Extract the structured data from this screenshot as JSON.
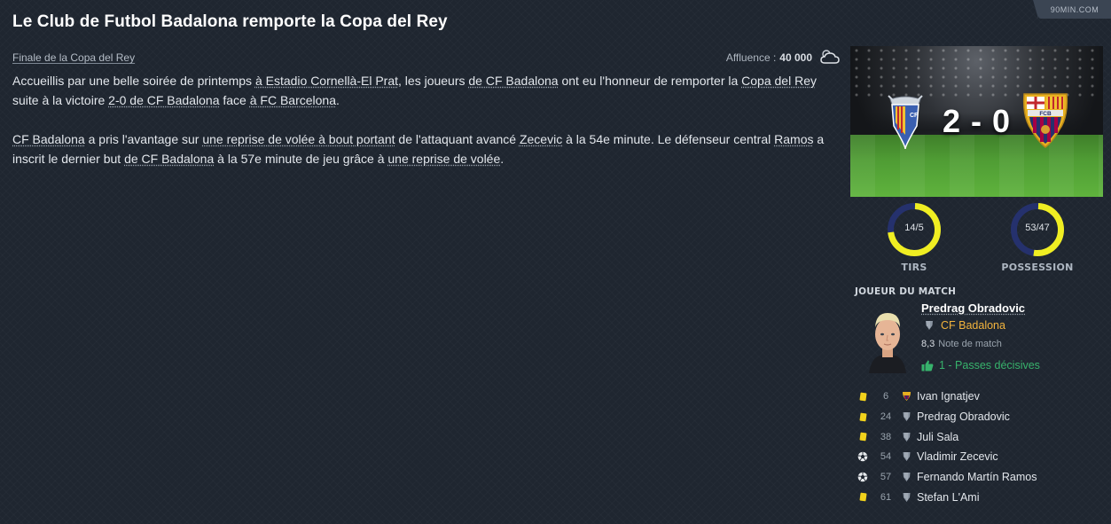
{
  "source": "90MIN.COM",
  "title": "Le Club de Futbol Badalona remporte la Copa del Rey",
  "subtitle": "Finale de la Copa del Rey",
  "attendance": {
    "label": "Affluence :",
    "value": "40 000",
    "weather_icon": "cloudy-icon"
  },
  "article": {
    "p1": [
      {
        "t": "Accueillis par une belle soirée de printemps "
      },
      {
        "t": "à Estadio Cornellà-El Prat",
        "link": true
      },
      {
        "t": ", les joueurs "
      },
      {
        "t": "de CF Badalona",
        "link": true
      },
      {
        "t": " ont eu l'honneur de remporter la "
      },
      {
        "t": "Copa del Rey",
        "link": true
      },
      {
        "t": " suite à la victoire "
      },
      {
        "t": "2-0 de CF Badalona",
        "link": true
      },
      {
        "t": " face "
      },
      {
        "t": "à FC Barcelona",
        "link": true
      },
      {
        "t": "."
      }
    ],
    "p2": [
      {
        "t": "CF Badalona",
        "link": true
      },
      {
        "t": " a pris l'avantage sur "
      },
      {
        "t": "une reprise de volée à bout portant",
        "link": true
      },
      {
        "t": " de l'attaquant avancé "
      },
      {
        "t": "Zecevic",
        "link": true
      },
      {
        "t": " à la 54e minute. Le défenseur central "
      },
      {
        "t": "Ramos",
        "link": true
      },
      {
        "t": " a inscrit le dernier but "
      },
      {
        "t": "de CF Badalona",
        "link": true
      },
      {
        "t": " à la 57e minute de jeu grâce à "
      },
      {
        "t": "une reprise de volée",
        "link": true
      },
      {
        "t": "."
      }
    ]
  },
  "match": {
    "score": "2 - 0",
    "home_team": "CF Badalona",
    "away_team": "FC Barcelona"
  },
  "stats": [
    {
      "key": "shots",
      "label": "TIRS",
      "value": "14/5",
      "home": 14,
      "away": 5
    },
    {
      "key": "possession",
      "label": "POSSESSION",
      "value": "53/47",
      "home": 53,
      "away": 47
    }
  ],
  "colors": {
    "home": "#f0ee22",
    "away": "#25316d",
    "accent": "#f2b33d",
    "positive": "#37b36c"
  },
  "potm": {
    "heading": "JOUEUR DU MATCH",
    "name": "Predrag Obradovic",
    "club": "CF Badalona",
    "rating": "8,3",
    "rating_label": "Note de match",
    "assists": "1 - Passes décisives"
  },
  "events": [
    {
      "icon": "yellow-card",
      "minute": "6",
      "team": "FC Barcelona",
      "player": "Ivan Ignatjev"
    },
    {
      "icon": "yellow-card",
      "minute": "24",
      "team": "CF Badalona",
      "player": "Predrag Obradovic"
    },
    {
      "icon": "yellow-card",
      "minute": "38",
      "team": "CF Badalona",
      "player": "Juli Sala"
    },
    {
      "icon": "goal-ball",
      "minute": "54",
      "team": "CF Badalona",
      "player": "Vladimir Zecevic"
    },
    {
      "icon": "goal-ball",
      "minute": "57",
      "team": "CF Badalona",
      "player": "Fernando Martín Ramos"
    },
    {
      "icon": "yellow-card",
      "minute": "61",
      "team": "CF Badalona",
      "player": "Stefan L'Ami"
    }
  ]
}
